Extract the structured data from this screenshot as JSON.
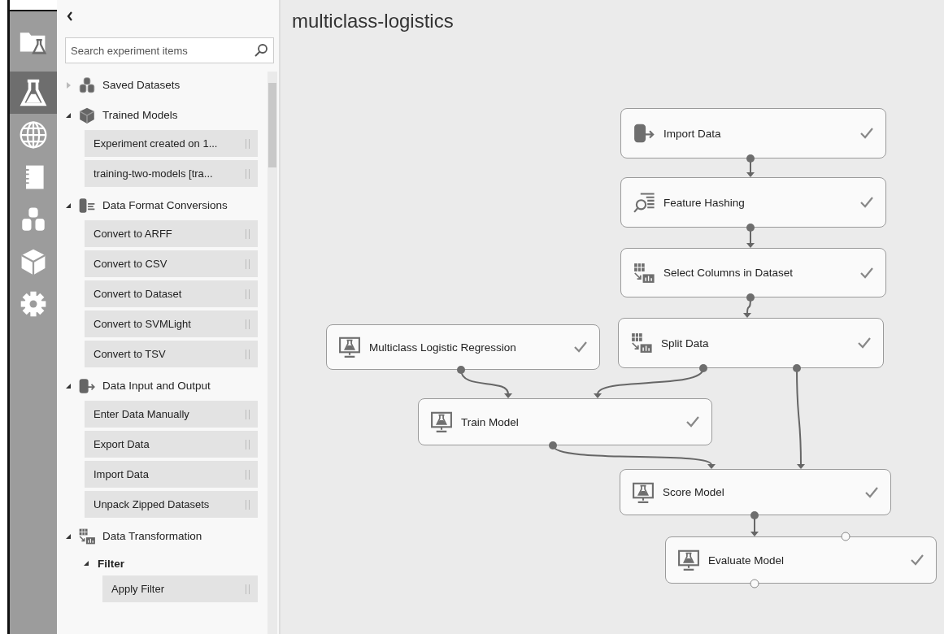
{
  "rail": [
    {
      "kind": "folder",
      "selected": false
    },
    {
      "kind": "flask",
      "selected": true
    },
    {
      "kind": "globe",
      "selected": false
    },
    {
      "kind": "notebook",
      "selected": false
    },
    {
      "kind": "datasets",
      "selected": false
    },
    {
      "kind": "cube",
      "selected": false
    },
    {
      "kind": "gear",
      "selected": false
    }
  ],
  "search": {
    "placeholder": "Search experiment items"
  },
  "palette": [
    {
      "label": "Saved Datasets",
      "kind": "datasets",
      "expanded": false
    },
    {
      "label": "Trained Models",
      "kind": "cube",
      "expanded": true,
      "children": [
        {
          "label": "Experiment created on 1..."
        },
        {
          "label": "training-two-models [tra..."
        }
      ]
    },
    {
      "label": "Data Format Conversions",
      "kind": "convert",
      "expanded": true,
      "children": [
        {
          "label": "Convert to ARFF"
        },
        {
          "label": "Convert to CSV"
        },
        {
          "label": "Convert to Dataset"
        },
        {
          "label": "Convert to SVMLight"
        },
        {
          "label": "Convert to TSV"
        }
      ]
    },
    {
      "label": "Data Input and Output",
      "kind": "import",
      "expanded": true,
      "children": [
        {
          "label": "Enter Data Manually"
        },
        {
          "label": "Export Data"
        },
        {
          "label": "Import Data"
        },
        {
          "label": "Unpack Zipped Datasets"
        }
      ]
    },
    {
      "label": "Data Transformation",
      "kind": "columns",
      "expanded": true,
      "children": [
        {
          "label": "Filter",
          "kind": "group",
          "expanded": true,
          "children": [
            {
              "label": "Apply Filter"
            }
          ]
        }
      ]
    }
  ],
  "experiment": {
    "title": "multiclass-logistics",
    "nodes": [
      {
        "label": "Import Data",
        "kind": "import",
        "done": true
      },
      {
        "label": "Feature Hashing",
        "kind": "hash",
        "done": true
      },
      {
        "label": "Select Columns in Dataset",
        "kind": "columns",
        "done": true
      },
      {
        "label": "Split Data",
        "kind": "columns",
        "done": true
      },
      {
        "label": "Multiclass Logistic Regression",
        "kind": "model",
        "done": true
      },
      {
        "label": "Train Model",
        "kind": "model",
        "done": true
      },
      {
        "label": "Score Model",
        "kind": "model",
        "done": true
      },
      {
        "label": "Evaluate Model",
        "kind": "model",
        "done": true
      }
    ]
  }
}
